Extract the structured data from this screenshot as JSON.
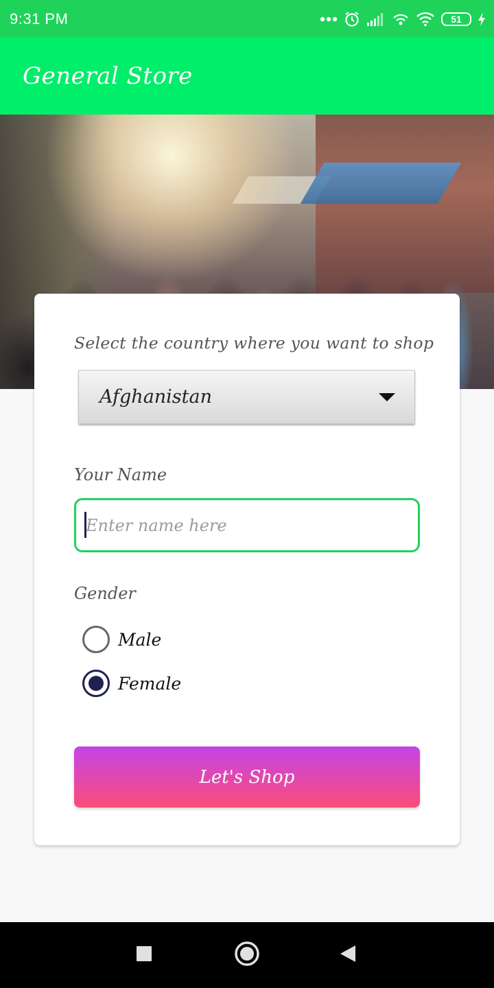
{
  "status_bar": {
    "time": "9:31 PM",
    "battery_level": "51",
    "icons": [
      "more-dots-icon",
      "alarm-icon",
      "signal-icon",
      "hotspot-icon",
      "wifi-icon",
      "battery-icon",
      "charging-icon"
    ]
  },
  "app_bar": {
    "title": "General Store"
  },
  "form": {
    "country_label": "Select the country where you want to shop",
    "country_selected": "Afghanistan",
    "name_label": "Your Name",
    "name_placeholder": "Enter name here",
    "name_value": "",
    "gender_label": "Gender",
    "gender_options": [
      {
        "label": "Male",
        "checked": false
      },
      {
        "label": "Female",
        "checked": true
      }
    ],
    "submit_label": "Let's  Shop"
  },
  "colors": {
    "status_bar": "#1fd35a",
    "app_bar": "#00ee6a",
    "input_border": "#1fd35a",
    "radio_checked": "#1f2150",
    "button_gradient_top": "#c543e8",
    "button_gradient_bottom": "#fb4d79"
  },
  "nav_bar": {
    "buttons": [
      "recent-apps-icon",
      "home-icon",
      "back-icon"
    ]
  }
}
